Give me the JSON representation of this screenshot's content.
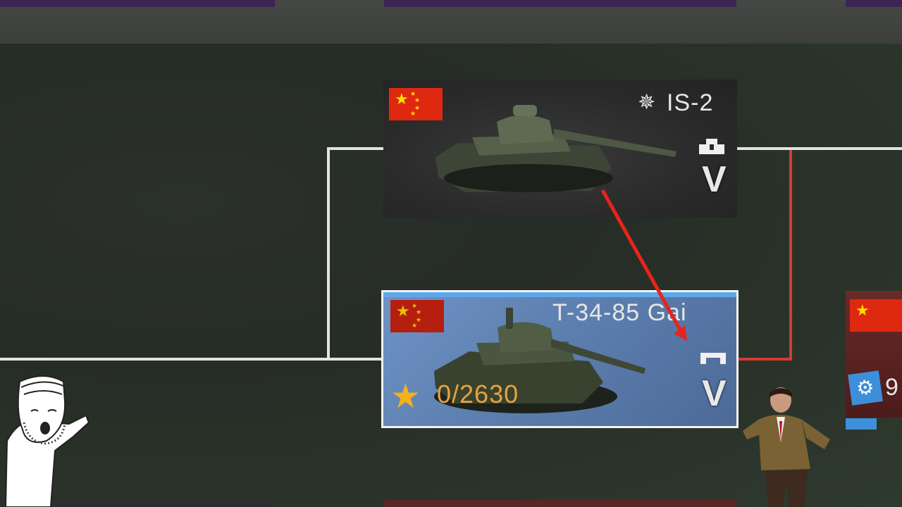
{
  "colors": {
    "tech_line": "#e3e3e3",
    "tech_line_red": "#d63a34",
    "flag_red": "#de2910",
    "flag_star": "#ffde00",
    "card_selected_blue": "#6f93c4",
    "research_points": "#e8a33c",
    "arrow_red": "#e8231c"
  },
  "vehicles": [
    {
      "name": "IS-2",
      "prefix_icon": "premium-star-icon",
      "nation_flag": "china-flag-icon",
      "class_icon": "heavy-tank-icon",
      "rank": "V",
      "selected": false
    },
    {
      "name": "T-34-85 Gai",
      "nation_flag": "china-flag-icon",
      "class_icon": "medium-tank-icon",
      "rank": "V",
      "selected": true,
      "research_icon": "star-icon",
      "research_progress": "0/2630",
      "research_progress_value": 0,
      "research_total_value": 2630
    }
  ],
  "side_card": {
    "nation_flag": "china-flag-icon",
    "status_icon": "gear-icon",
    "status_text_partial": "9"
  },
  "annotation": {
    "arrow": "red-arrow-icon",
    "left_meme": "pointing-wojak-icon",
    "right_meme": "man-checking-watch-icon"
  }
}
